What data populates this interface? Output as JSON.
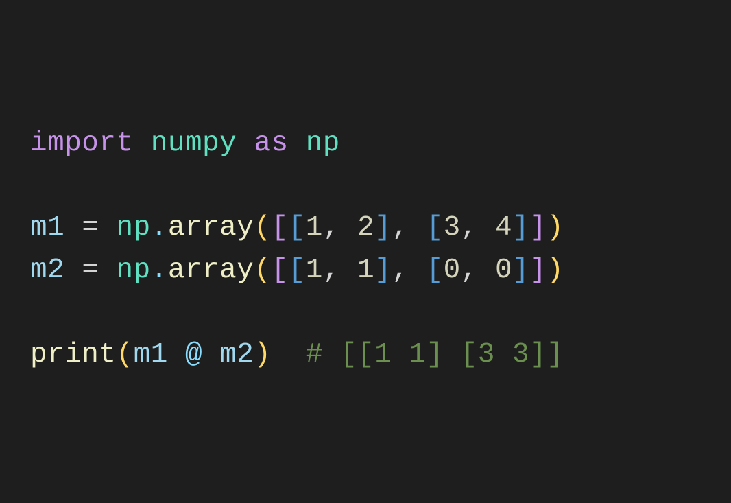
{
  "code": {
    "line1": {
      "kw_import": "import",
      "module": "numpy",
      "kw_as": "as",
      "alias": "np"
    },
    "line3": {
      "var": "m1",
      "eq": "=",
      "ns": "np",
      "dot": ".",
      "fn": "array",
      "lparen_y": "(",
      "lbrack_p1": "[",
      "lbrack_b1": "[",
      "n1": "1",
      "c1": ",",
      "n2": "2",
      "rbrack_b1": "]",
      "c2": ",",
      "lbrack_b2": "[",
      "n3": "3",
      "c3": ",",
      "n4": "4",
      "rbrack_b2": "]",
      "rbrack_p1": "]",
      "rparen_y": ")"
    },
    "line4": {
      "var": "m2",
      "eq": "=",
      "ns": "np",
      "dot": ".",
      "fn": "array",
      "lparen_y": "(",
      "lbrack_p1": "[",
      "lbrack_b1": "[",
      "n1": "1",
      "c1": ",",
      "n2": "1",
      "rbrack_b1": "]",
      "c2": ",",
      "lbrack_b2": "[",
      "n3": "0",
      "c3": ",",
      "n4": "0",
      "rbrack_b2": "]",
      "rbrack_p1": "]",
      "rparen_y": ")"
    },
    "line6": {
      "fn": "print",
      "lparen_y": "(",
      "v1": "m1",
      "at": "@",
      "v2": "m2",
      "rparen_y": ")",
      "comment": "# [[1 1] [3 3]]"
    }
  }
}
